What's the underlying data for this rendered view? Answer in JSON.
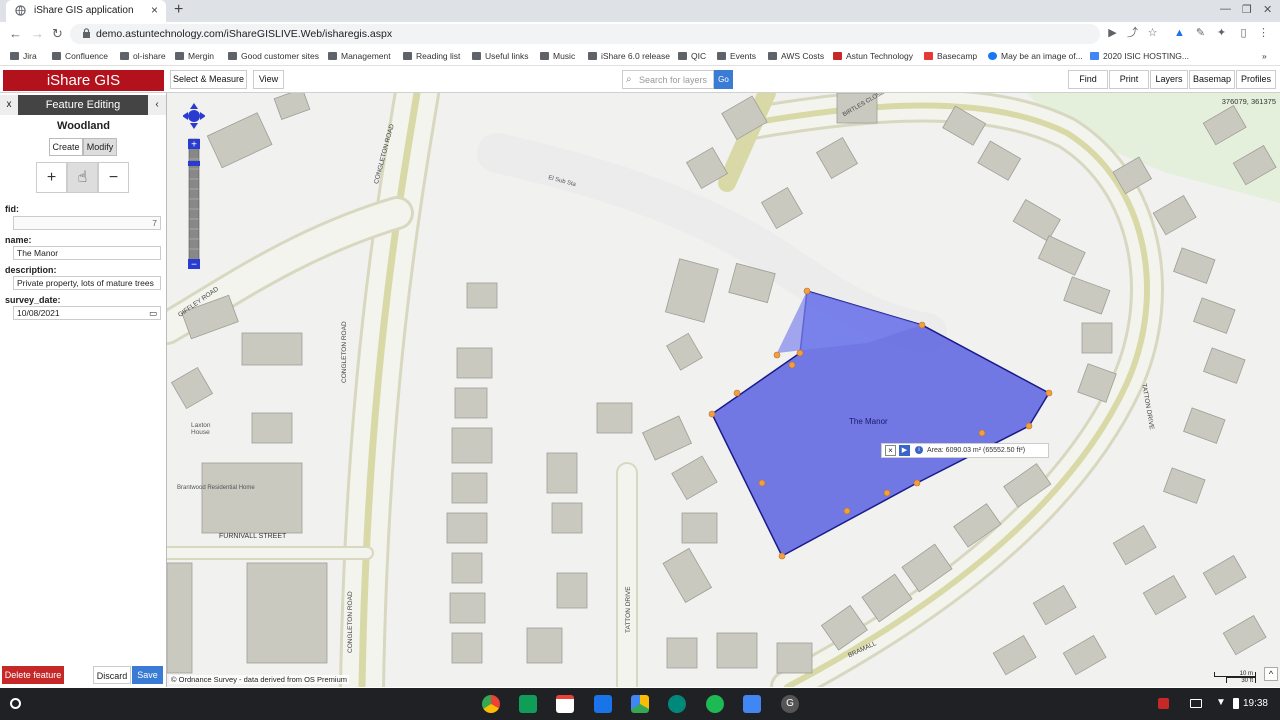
{
  "browser": {
    "tab_title": "iShare GIS application",
    "url": "demo.astuntechnology.com/iShareGISLIVE.Web/isharegis.aspx",
    "bookmarks": [
      "Jira",
      "Confluence",
      "ol-ishare",
      "Mergin",
      "Good customer sites",
      "Management",
      "Reading list",
      "Useful links",
      "Music",
      "iShare 6.0 release",
      "QIC",
      "Events",
      "AWS Costs",
      "Astun Technology",
      "Basecamp",
      "May be an image of...",
      "2020 ISIC HOSTING..."
    ]
  },
  "app": {
    "logo": "iShare GIS",
    "toolbar_left": [
      "Select & Measure",
      "View"
    ],
    "search_placeholder": "Search for layers",
    "go_label": "Go",
    "toolbar_right": [
      "Find",
      "Print",
      "Layers",
      "Basemap",
      "Profiles"
    ]
  },
  "panel": {
    "close_label": "x",
    "title": "Feature Editing",
    "collapse_label": "‹",
    "layer_name": "Woodland",
    "modes": [
      "Create",
      "Modify"
    ],
    "active_mode": "Modify",
    "tools": [
      "+",
      "☝",
      "−"
    ],
    "fields": [
      {
        "label": "fid:",
        "value": "7"
      },
      {
        "label": "name:",
        "value": "The Manor"
      },
      {
        "label": "description:",
        "value": "Private property, lots of mature trees"
      },
      {
        "label": "survey_date:",
        "value": "10/08/2021"
      }
    ],
    "delete_label": "Delete feature",
    "discard_label": "Discard",
    "save_label": "Save"
  },
  "map": {
    "coords": "376079, 361375",
    "attribution": "© Ordnance Survey - data derived from OS Premium",
    "feature_label": "The Manor",
    "area_text": "Area: 6090.03 m² (65552.50 ft²)",
    "scale_top": "10 m",
    "scale_bottom": "30 ft",
    "street_labels": [
      "CONGLETON ROAD",
      "GIFFLEY ROAD",
      "FURNIVALL STREET",
      "CONGLETON ROAD",
      "CONGLETON ROAD",
      "BIRTLES CLOSE",
      "TATTON DRIVE",
      "TATTON DRIVE",
      "BRAMALL"
    ],
    "place_labels": [
      "Laxton House",
      "Brantwood Residential Home",
      "El Sub Sta"
    ],
    "colors": {
      "feature_fill": "#5b63e0",
      "feature_stroke": "#1a1a8c",
      "vertex": "#f0a040",
      "road": "#d9d9a8",
      "building": "#c9c9c0"
    }
  },
  "taskbar": {
    "time": "19:38"
  }
}
